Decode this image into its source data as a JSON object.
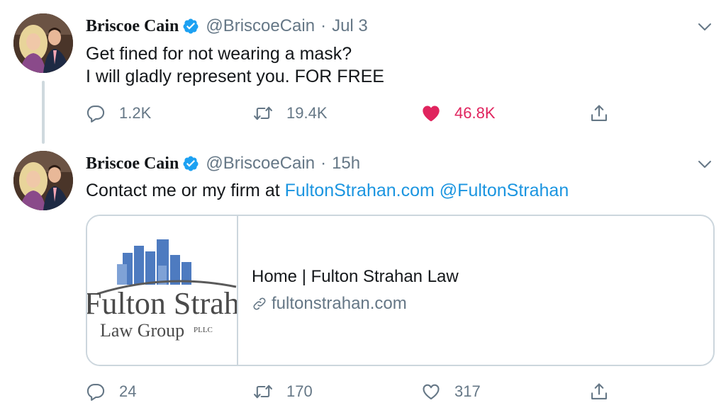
{
  "tweets": [
    {
      "author_name": "Briscoe Cain",
      "handle": "@BriscoeCain",
      "separator": "·",
      "time": "Jul 3",
      "text_lines": [
        "Get fined for not wearing a mask?",
        "I will gladly represent you. FOR FREE"
      ],
      "stats": {
        "replies": "1.2K",
        "retweets": "19.4K",
        "likes": "46.8K"
      },
      "liked": true
    },
    {
      "author_name": "Briscoe Cain",
      "handle": "@BriscoeCain",
      "separator": "·",
      "time": "15h",
      "text_prefix": "Contact me or my firm at ",
      "link_url_text": "FultonStrahan.com",
      "mention": "@FultonStrahan",
      "card": {
        "title": "Home | Fulton Strahan Law",
        "url": "fultonstrahan.com",
        "logo_text_main": "Fulton Strahan",
        "logo_text_sub": "Law Group",
        "logo_text_suffix": "PLLC"
      },
      "stats": {
        "replies": "24",
        "retweets": "170",
        "likes": "317"
      },
      "liked": false
    }
  ],
  "colors": {
    "text": "#14171a",
    "secondary": "#657786",
    "link": "#1b95e0",
    "like": "#e0245e",
    "verified": "#1da1f2",
    "border": "#ccd6dd"
  },
  "icons": [
    "verified-badge-icon",
    "chevron-down-icon",
    "reply-icon",
    "retweet-icon",
    "heart-icon",
    "share-icon",
    "link-icon"
  ]
}
